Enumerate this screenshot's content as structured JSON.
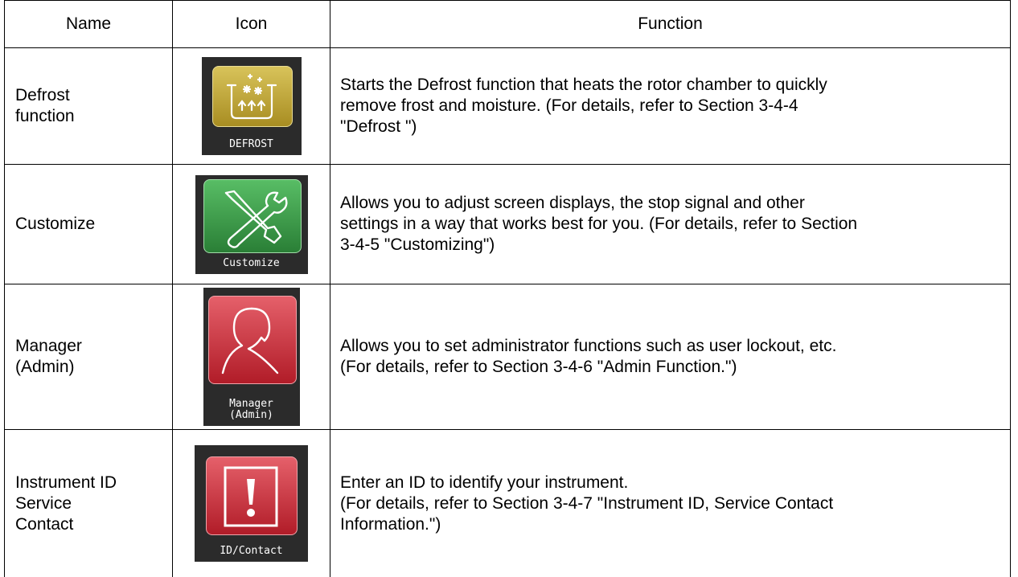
{
  "headers": {
    "name": "Name",
    "icon": "Icon",
    "function": "Function"
  },
  "rows": [
    {
      "name_lines": [
        "Defrost",
        "function"
      ],
      "icon_caption": [
        "DEFROST"
      ],
      "icon_name": "defrost-icon",
      "icon_color": "#b49a2a",
      "function_lines": [
        "Starts the Defrost function that heats the rotor chamber to quickly",
        "remove frost and moisture. (For details, refer to Section 3-4-4",
        "\"Defrost \")"
      ]
    },
    {
      "name_lines": [
        "Customize"
      ],
      "icon_caption": [
        "Customize"
      ],
      "icon_name": "wrench-screwdriver-icon",
      "icon_color": "#3e9a4a",
      "function_lines": [
        "Allows you to adjust screen displays, the stop signal and other",
        "settings in a way that works best for you. (For details, refer to Section",
        "3-4-5 \"Customizing\")"
      ]
    },
    {
      "name_lines": [
        "Manager",
        "(Admin)"
      ],
      "icon_caption": [
        "Manager",
        "(Admin)"
      ],
      "icon_name": "person-icon",
      "icon_color": "#cc2b36",
      "function_lines": [
        "Allows you to set administrator functions such as user lockout, etc.",
        "(For details, refer to Section 3-4-6 \"Admin Function.\")"
      ]
    },
    {
      "name_lines": [
        "Instrument ID",
        "Service",
        "Contact"
      ],
      "icon_caption": [
        "ID/Contact"
      ],
      "icon_name": "exclamation-icon",
      "icon_color": "#cc2b36",
      "function_lines": [
        "Enter an ID to identify your instrument.",
        "(For details, refer to Section 3-4-7 \"Instrument ID, Service Contact",
        "Information.\")"
      ]
    }
  ]
}
